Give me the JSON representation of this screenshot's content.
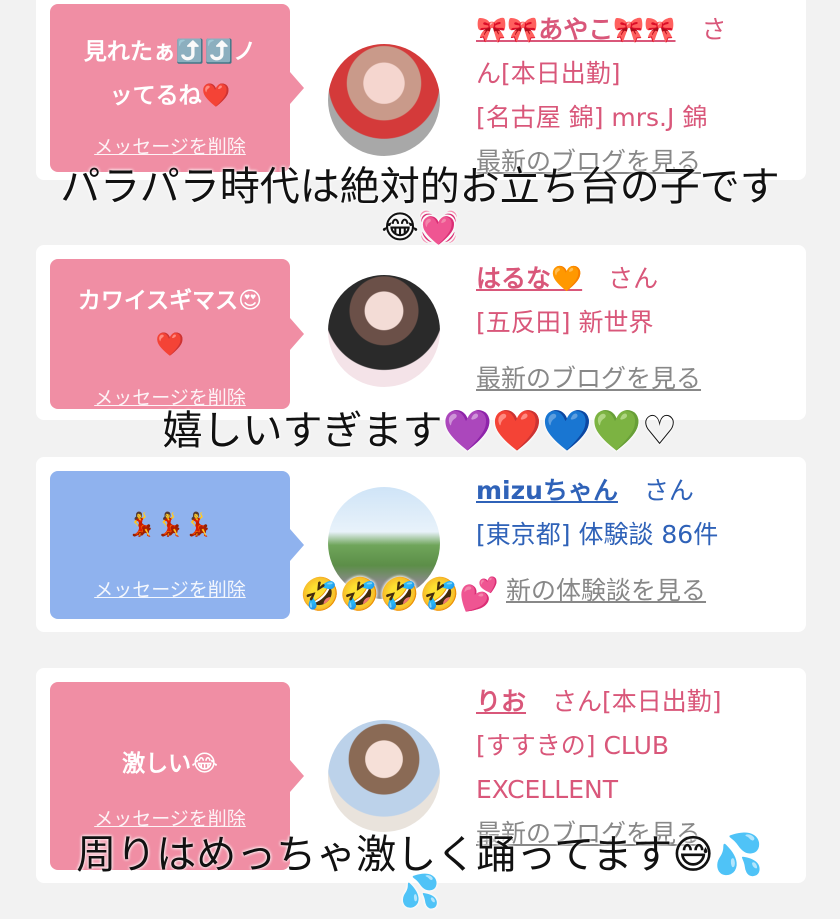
{
  "cards": [
    {
      "message_lines": [
        "見れたぁ⤴️⤴️ノ",
        "ッてるね❤️"
      ],
      "delete_label": "メッセージを削除",
      "name": "🎀🎀あやこ🎀🎀",
      "suffix": "さ",
      "line2": "ん[本日出勤]",
      "line3": "[名古屋 錦] mrs.J 錦",
      "link": "最新のブログを見る"
    },
    {
      "message_lines": [
        "カワイスギマス😍",
        "❤️"
      ],
      "delete_label": "メッセージを削除",
      "name": "はるな🧡",
      "suffix": "さん",
      "line2": "[五反田] 新世界",
      "link": "最新のブログを見る"
    },
    {
      "message_lines": [
        "💃💃💃"
      ],
      "delete_label": "メッセージを削除",
      "name": "mizuちゃん",
      "suffix": "さん",
      "line2": "[東京都] 体験談 86件",
      "link": "新の体験談を見る"
    },
    {
      "message_lines": [
        "激しい😂"
      ],
      "delete_label": "メッセージを削除",
      "name": "りお",
      "suffix": "さん[本日出勤]",
      "line2": "[すすきの] CLUB",
      "line3": "EXCELLENT",
      "link": "最新のブログを見る"
    }
  ],
  "overlays": {
    "caption1": "パラパラ時代は絶対的お立ち台の子です",
    "caption1_emoji": "😂💓",
    "caption2": "嬉しいすぎます💜❤️💙💚♡",
    "caption3": "🤣🤣🤣🤣💕",
    "caption4": "周りはめっちゃ激しく踊ってます😅💦",
    "caption4_emoji": "💦"
  },
  "colors": {
    "pink_bubble": "#f08ea4",
    "blue_bubble": "#8fb2ee",
    "pink_text": "#d9577a",
    "blue_text": "#2f62b8"
  }
}
